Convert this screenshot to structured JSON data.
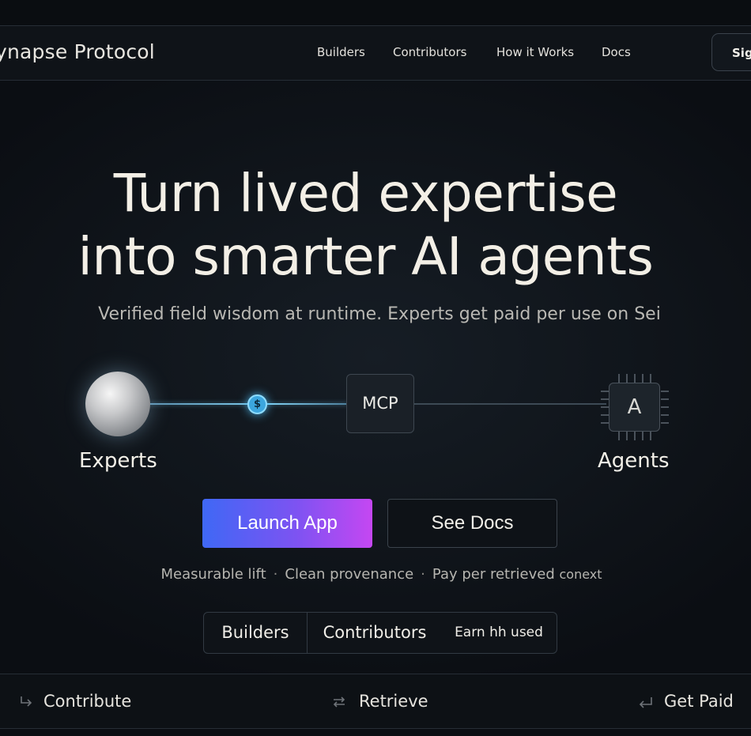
{
  "nav": {
    "brand": "ynapse Protocol",
    "links": [
      "Builders",
      "Contributors",
      "How it Works",
      "Docs"
    ],
    "signin_label": "Sig"
  },
  "hero": {
    "headline_line1": "Turn lived expertise",
    "headline_line2": "into smarter AI agents",
    "subheadline": "Verified field wisdom at runtime. Experts get paid per use on Sei"
  },
  "flow": {
    "experts_label": "Experts",
    "coin_symbol": "$",
    "mcp_label": "MCP",
    "agent_chip_letter": "A",
    "agents_label": "Agents"
  },
  "cta": {
    "launch_label": "Launch App",
    "docs_label": "See Docs"
  },
  "features": [
    "Measurable lift",
    "Clean provenance",
    "Pay per retrieved",
    "conext"
  ],
  "segmented": {
    "items": [
      "Builders",
      "Contributors",
      "Earn hh used"
    ]
  },
  "steps": [
    {
      "icon": "contribute-arrow-icon",
      "label": "Contribute"
    },
    {
      "icon": "retrieve-arrows-icon",
      "label": "Retrieve"
    },
    {
      "icon": "get-paid-return-icon",
      "label": "Get Paid"
    }
  ],
  "colors": {
    "background": "#0c1015",
    "launch_gradient_start": "#3f68f5",
    "launch_gradient_end": "#c547f2",
    "flow_glow": "#7fd0f2"
  }
}
